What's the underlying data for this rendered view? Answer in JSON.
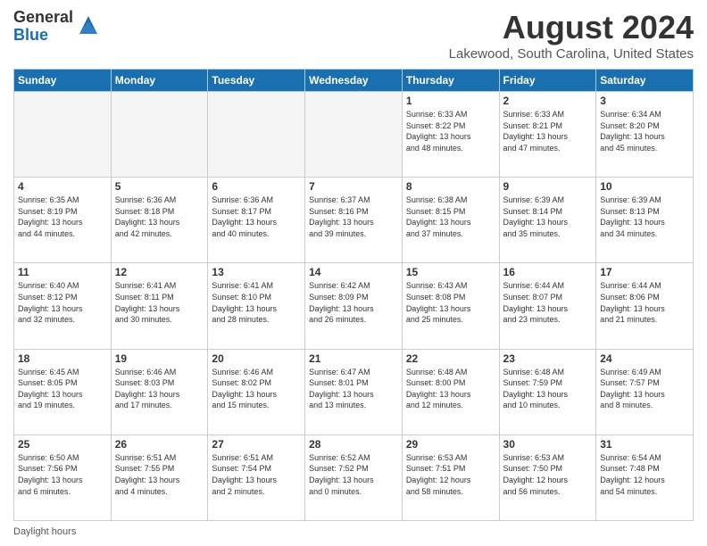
{
  "logo": {
    "general": "General",
    "blue": "Blue"
  },
  "title": "August 2024",
  "subtitle": "Lakewood, South Carolina, United States",
  "days_header": [
    "Sunday",
    "Monday",
    "Tuesday",
    "Wednesday",
    "Thursday",
    "Friday",
    "Saturday"
  ],
  "footer": "Daylight hours",
  "weeks": [
    [
      {
        "day": "",
        "info": ""
      },
      {
        "day": "",
        "info": ""
      },
      {
        "day": "",
        "info": ""
      },
      {
        "day": "",
        "info": ""
      },
      {
        "day": "1",
        "info": "Sunrise: 6:33 AM\nSunset: 8:22 PM\nDaylight: 13 hours\nand 48 minutes."
      },
      {
        "day": "2",
        "info": "Sunrise: 6:33 AM\nSunset: 8:21 PM\nDaylight: 13 hours\nand 47 minutes."
      },
      {
        "day": "3",
        "info": "Sunrise: 6:34 AM\nSunset: 8:20 PM\nDaylight: 13 hours\nand 45 minutes."
      }
    ],
    [
      {
        "day": "4",
        "info": "Sunrise: 6:35 AM\nSunset: 8:19 PM\nDaylight: 13 hours\nand 44 minutes."
      },
      {
        "day": "5",
        "info": "Sunrise: 6:36 AM\nSunset: 8:18 PM\nDaylight: 13 hours\nand 42 minutes."
      },
      {
        "day": "6",
        "info": "Sunrise: 6:36 AM\nSunset: 8:17 PM\nDaylight: 13 hours\nand 40 minutes."
      },
      {
        "day": "7",
        "info": "Sunrise: 6:37 AM\nSunset: 8:16 PM\nDaylight: 13 hours\nand 39 minutes."
      },
      {
        "day": "8",
        "info": "Sunrise: 6:38 AM\nSunset: 8:15 PM\nDaylight: 13 hours\nand 37 minutes."
      },
      {
        "day": "9",
        "info": "Sunrise: 6:39 AM\nSunset: 8:14 PM\nDaylight: 13 hours\nand 35 minutes."
      },
      {
        "day": "10",
        "info": "Sunrise: 6:39 AM\nSunset: 8:13 PM\nDaylight: 13 hours\nand 34 minutes."
      }
    ],
    [
      {
        "day": "11",
        "info": "Sunrise: 6:40 AM\nSunset: 8:12 PM\nDaylight: 13 hours\nand 32 minutes."
      },
      {
        "day": "12",
        "info": "Sunrise: 6:41 AM\nSunset: 8:11 PM\nDaylight: 13 hours\nand 30 minutes."
      },
      {
        "day": "13",
        "info": "Sunrise: 6:41 AM\nSunset: 8:10 PM\nDaylight: 13 hours\nand 28 minutes."
      },
      {
        "day": "14",
        "info": "Sunrise: 6:42 AM\nSunset: 8:09 PM\nDaylight: 13 hours\nand 26 minutes."
      },
      {
        "day": "15",
        "info": "Sunrise: 6:43 AM\nSunset: 8:08 PM\nDaylight: 13 hours\nand 25 minutes."
      },
      {
        "day": "16",
        "info": "Sunrise: 6:44 AM\nSunset: 8:07 PM\nDaylight: 13 hours\nand 23 minutes."
      },
      {
        "day": "17",
        "info": "Sunrise: 6:44 AM\nSunset: 8:06 PM\nDaylight: 13 hours\nand 21 minutes."
      }
    ],
    [
      {
        "day": "18",
        "info": "Sunrise: 6:45 AM\nSunset: 8:05 PM\nDaylight: 13 hours\nand 19 minutes."
      },
      {
        "day": "19",
        "info": "Sunrise: 6:46 AM\nSunset: 8:03 PM\nDaylight: 13 hours\nand 17 minutes."
      },
      {
        "day": "20",
        "info": "Sunrise: 6:46 AM\nSunset: 8:02 PM\nDaylight: 13 hours\nand 15 minutes."
      },
      {
        "day": "21",
        "info": "Sunrise: 6:47 AM\nSunset: 8:01 PM\nDaylight: 13 hours\nand 13 minutes."
      },
      {
        "day": "22",
        "info": "Sunrise: 6:48 AM\nSunset: 8:00 PM\nDaylight: 13 hours\nand 12 minutes."
      },
      {
        "day": "23",
        "info": "Sunrise: 6:48 AM\nSunset: 7:59 PM\nDaylight: 13 hours\nand 10 minutes."
      },
      {
        "day": "24",
        "info": "Sunrise: 6:49 AM\nSunset: 7:57 PM\nDaylight: 13 hours\nand 8 minutes."
      }
    ],
    [
      {
        "day": "25",
        "info": "Sunrise: 6:50 AM\nSunset: 7:56 PM\nDaylight: 13 hours\nand 6 minutes."
      },
      {
        "day": "26",
        "info": "Sunrise: 6:51 AM\nSunset: 7:55 PM\nDaylight: 13 hours\nand 4 minutes."
      },
      {
        "day": "27",
        "info": "Sunrise: 6:51 AM\nSunset: 7:54 PM\nDaylight: 13 hours\nand 2 minutes."
      },
      {
        "day": "28",
        "info": "Sunrise: 6:52 AM\nSunset: 7:52 PM\nDaylight: 13 hours\nand 0 minutes."
      },
      {
        "day": "29",
        "info": "Sunrise: 6:53 AM\nSunset: 7:51 PM\nDaylight: 12 hours\nand 58 minutes."
      },
      {
        "day": "30",
        "info": "Sunrise: 6:53 AM\nSunset: 7:50 PM\nDaylight: 12 hours\nand 56 minutes."
      },
      {
        "day": "31",
        "info": "Sunrise: 6:54 AM\nSunset: 7:48 PM\nDaylight: 12 hours\nand 54 minutes."
      }
    ]
  ]
}
